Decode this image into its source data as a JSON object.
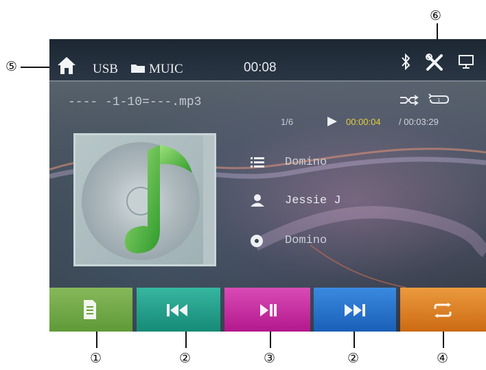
{
  "callouts": {
    "c1": "①",
    "c2a": "②",
    "c3": "③",
    "c2b": "②",
    "c4": "④",
    "c5": "⑤",
    "c6": "⑥"
  },
  "status_bar": {
    "source": "USB",
    "folder": "MUIC",
    "time": "00:08"
  },
  "now_playing": {
    "filename": "---- -1-10=---.mp3",
    "track_index": "1/6",
    "elapsed": "00:00:04",
    "total": "/ 00:03:29",
    "title": "Domino",
    "artist": "Jessie J",
    "album": "Domino"
  },
  "colors": {
    "btn_list": "#6aa33c",
    "btn_prev": "#1f9e8a",
    "btn_play": "#c5259f",
    "btn_next": "#1f6fc7",
    "btn_repeat": "#e07d1f",
    "elapsed": "#e3cf3a"
  },
  "icons": {
    "home": "home-icon",
    "folder": "folder-icon",
    "bluetooth": "bluetooth-icon",
    "settings": "settings-icon",
    "display": "display-icon",
    "shuffle": "shuffle-icon",
    "repeat_mode": "repeat-mode-icon",
    "play_state": "play-state-icon",
    "list": "list-icon",
    "artist": "artist-icon",
    "album": "album-icon",
    "file_list": "file-list-icon",
    "previous": "previous-icon",
    "play_pause": "play-pause-icon",
    "next": "next-icon",
    "repeat": "repeat-icon",
    "album_art": "music-note-icon"
  }
}
